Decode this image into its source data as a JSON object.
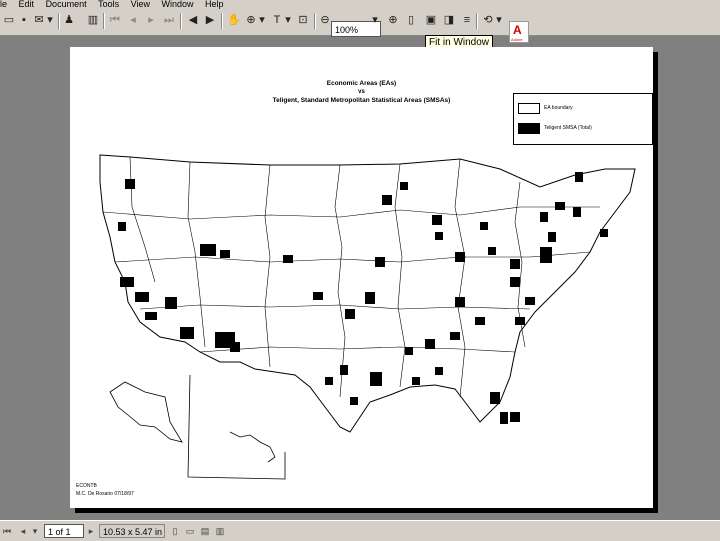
{
  "menu": [
    "le",
    "Edit",
    "Document",
    "Tools",
    "View",
    "Window",
    "Help"
  ],
  "toolbar": {
    "zoom_value": "100%",
    "tooltip": "Fit in Window",
    "logo_text": "Adobe"
  },
  "document": {
    "title_line1": "Economic Areas (EAs)",
    "title_line2": "vs",
    "title_line3": "Teligent, Standard Metropolitan Statistical Areas (SMSAs)",
    "legend": [
      {
        "label": "EA boundary",
        "color": "#ffffff"
      },
      {
        "label": "Teligent SMSA (Total)",
        "color": "#000000"
      }
    ],
    "credit1": "ECONTB",
    "credit2": "M.C. De Rosario 07/18/97"
  },
  "status": {
    "page": "1 of 1",
    "size": "10.53 x 5.47 in"
  }
}
